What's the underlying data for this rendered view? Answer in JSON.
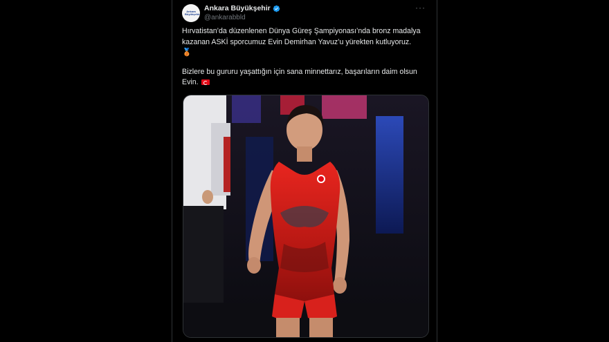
{
  "tweet": {
    "display_name": "Ankara Büyükşehir",
    "handle": "@ankarabbld",
    "avatar_logo_text": "Ankara Büyükşehir",
    "more_label": "···",
    "paragraph1": "Hırvatistan’da düzenlenen Dünya Güreş Şampiyonası’nda bronz madalya kazanan ASKİ sporcumuz Evin Demirhan Yavuz’u yürekten kutluyoruz.",
    "medal_emoji": "🥉",
    "paragraph2": "Bizlere bu gururu yaşattığın için sana minnettarız, başarıların daim olsun Evin.",
    "flag_icon": "turkey-flag-icon"
  },
  "colors": {
    "background": "#000000",
    "text": "#e7e9ea",
    "secondary_text": "#71767b",
    "verified_blue": "#1d9bf0",
    "singlet_red": "#d8211c"
  }
}
